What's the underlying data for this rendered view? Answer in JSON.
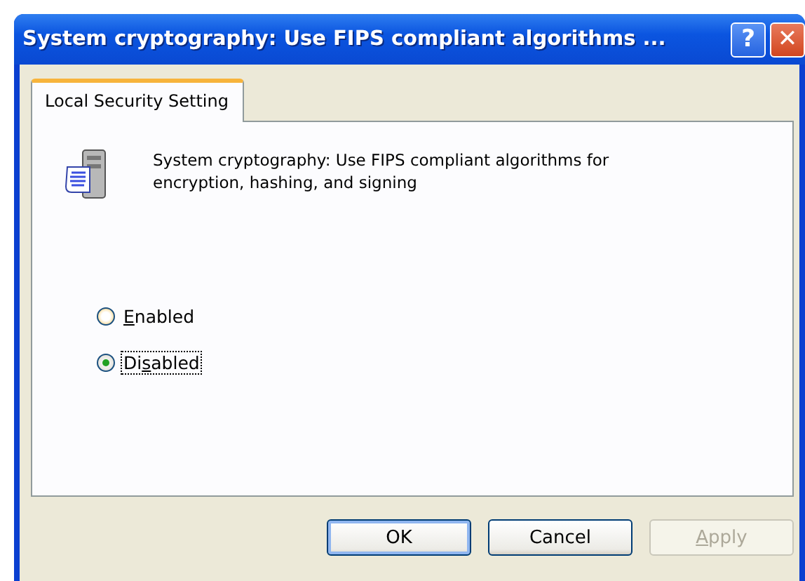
{
  "window": {
    "title": "System cryptography: Use FIPS compliant algorithms ...",
    "help_button": "?",
    "close_button": "✕"
  },
  "tabs": [
    {
      "label": "Local Security Setting",
      "selected": true
    }
  ],
  "policy": {
    "description": "System cryptography: Use FIPS compliant algorithms for encryption, hashing, and signing"
  },
  "options": [
    {
      "label": {
        "access_key": "E",
        "after": "nabled"
      },
      "selected": false,
      "focused": false
    },
    {
      "label": {
        "before": "Di",
        "access_key": "s",
        "after": "abled"
      },
      "selected": true,
      "focused": true
    }
  ],
  "buttons": [
    {
      "label": {
        "before": "OK"
      },
      "disabled": false,
      "default": true
    },
    {
      "label": {
        "before": "Cancel"
      },
      "disabled": false,
      "default": false
    },
    {
      "label": {
        "access_key": "A",
        "after": "pply"
      },
      "disabled": true,
      "default": false
    }
  ]
}
